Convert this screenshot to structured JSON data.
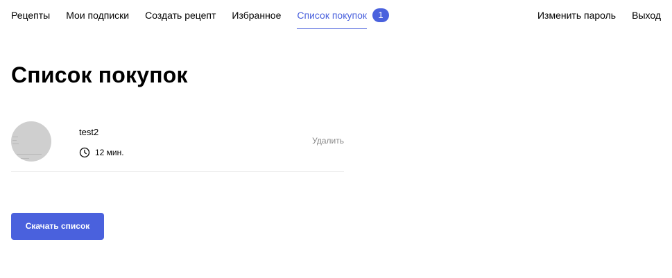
{
  "nav": {
    "left_items": [
      {
        "label": "Рецепты"
      },
      {
        "label": "Мои подписки"
      },
      {
        "label": "Создать рецепт"
      },
      {
        "label": "Избранное"
      },
      {
        "label": "Список покупок",
        "active": true,
        "badge": "1"
      }
    ],
    "right_items": [
      {
        "label": "Изменить пароль"
      },
      {
        "label": "Выход"
      }
    ]
  },
  "main": {
    "title": "Список покупок",
    "items": [
      {
        "name": "test2",
        "time": "12 мин.",
        "delete_label": "Удалить"
      }
    ],
    "download_label": "Скачать список"
  },
  "colors": {
    "accent": "#4A61DD",
    "text": "#000000",
    "muted": "#888888",
    "divider": "#eeeeee"
  },
  "icons": {
    "time": "clock-icon"
  }
}
